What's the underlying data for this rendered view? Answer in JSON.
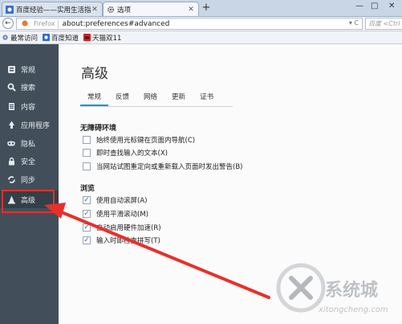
{
  "tabs": [
    {
      "title": "百度经验——实用生活指南",
      "active": false
    },
    {
      "title": "选项",
      "active": true
    }
  ],
  "nav": {
    "url_prefix": "Firefox",
    "url": "about:preferences#advanced",
    "search_placeholder": "百度 <Ctrl"
  },
  "bookmarks": [
    {
      "label": "最常访问",
      "icon": "gear-icon"
    },
    {
      "label": "百度知道",
      "icon": "baidu-icon"
    },
    {
      "label": "天猫双11",
      "icon": "tmall-icon"
    }
  ],
  "sidebar": {
    "items": [
      {
        "label": "常规",
        "icon": "general-icon"
      },
      {
        "label": "搜索",
        "icon": "search-icon"
      },
      {
        "label": "内容",
        "icon": "content-icon"
      },
      {
        "label": "应用程序",
        "icon": "applications-icon"
      },
      {
        "label": "隐私",
        "icon": "privacy-mask-icon"
      },
      {
        "label": "安全",
        "icon": "lock-icon"
      },
      {
        "label": "同步",
        "icon": "sync-icon"
      },
      {
        "label": "高级",
        "icon": "wizard-hat-icon",
        "active": true
      }
    ]
  },
  "main": {
    "title": "高级",
    "tabs": [
      "常规",
      "反馈",
      "网络",
      "更新",
      "证书"
    ],
    "active_tab": "常规",
    "accessibility": {
      "title": "无障碍环境",
      "options": [
        {
          "label": "始终使用光标键在页面内导航(C)",
          "checked": false
        },
        {
          "label": "即时查找输入的文本(X)",
          "checked": false
        },
        {
          "label": "当网站试图重定向或重新载入页面时发出警告(B)",
          "checked": false
        }
      ]
    },
    "browsing": {
      "title": "浏览",
      "options": [
        {
          "label": "使用自动滚屏(A)",
          "checked": true
        },
        {
          "label": "使用平滑滚动(M)",
          "checked": true
        },
        {
          "label": "自动启用硬件加速(R)",
          "checked": true
        },
        {
          "label": "输入时即检查拼写(T)",
          "checked": true
        }
      ]
    }
  },
  "colors": {
    "sidebar_bg": "#424f5a",
    "accent": "#0095dd",
    "annotation": "#e8302a"
  },
  "watermark": {
    "text": "系统城",
    "domain": "xitongcheng.com"
  }
}
